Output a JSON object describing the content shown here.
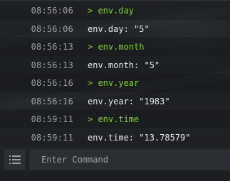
{
  "console": {
    "rows": [
      {
        "kind": "cmd",
        "time": "08:56:06",
        "text": "> env.day"
      },
      {
        "kind": "out",
        "time": "08:56:06",
        "text": "env.day: \"5\""
      },
      {
        "kind": "cmd",
        "time": "08:56:13",
        "text": "> env.month"
      },
      {
        "kind": "out",
        "time": "08:56:13",
        "text": "env.month: \"5\""
      },
      {
        "kind": "cmd",
        "time": "08:56:16",
        "text": "> env.year"
      },
      {
        "kind": "out",
        "time": "08:56:16",
        "text": "env.year: \"1983\""
      },
      {
        "kind": "cmd",
        "time": "08:59:11",
        "text": "> env.time"
      },
      {
        "kind": "out",
        "time": "08:59:11",
        "text": "env.time: \"13.78579\""
      }
    ]
  },
  "input_bar": {
    "menu_icon": "list-icon",
    "placeholder": "Enter Command",
    "value": ""
  },
  "colors": {
    "command": "#7ed321",
    "output": "#e6e8ea",
    "timestamp": "#9aa0a6",
    "panel": "#2b2f33"
  }
}
